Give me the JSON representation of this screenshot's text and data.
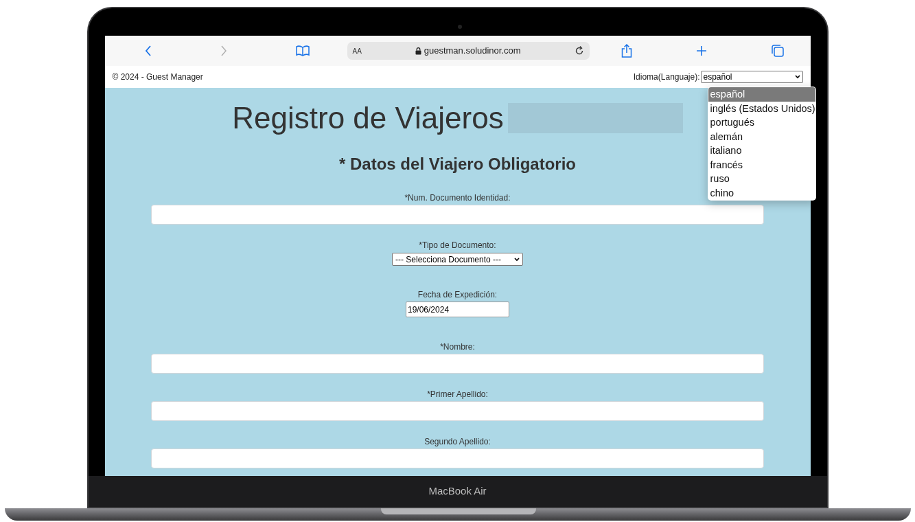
{
  "browser": {
    "reader_label": "AA",
    "url": "guestman.soludinor.com"
  },
  "header": {
    "copyright": "© 2024 - Guest Manager",
    "language_label": "Idioma(Languaje):",
    "language_value": "español"
  },
  "language_menu": {
    "options": [
      {
        "label": "español",
        "selected": true
      },
      {
        "label": "inglés (Estados Unidos)",
        "selected": false
      },
      {
        "label": "portugués",
        "selected": false
      },
      {
        "label": "alemán",
        "selected": false
      },
      {
        "label": "italiano",
        "selected": false
      },
      {
        "label": "francés",
        "selected": false
      },
      {
        "label": "ruso",
        "selected": false
      },
      {
        "label": "chino",
        "selected": false
      }
    ]
  },
  "page": {
    "title": "Registro de Viajeros",
    "section_heading": "* Datos del Viajero Obligatorio",
    "fields": [
      {
        "kind": "text",
        "label": "*Num. Documento Identidad:"
      },
      {
        "kind": "select",
        "label": "*Tipo de Documento:",
        "value": "--- Selecciona Documento ---"
      },
      {
        "kind": "date",
        "label": "Fecha de Expedición:",
        "value": "19/06/2024"
      },
      {
        "kind": "text",
        "label": "*Nombre:"
      },
      {
        "kind": "text",
        "label": "*Primer Apellido:"
      },
      {
        "kind": "text",
        "label": "Segundo Apellido:"
      }
    ]
  },
  "device": {
    "label": "MacBook Air"
  }
}
